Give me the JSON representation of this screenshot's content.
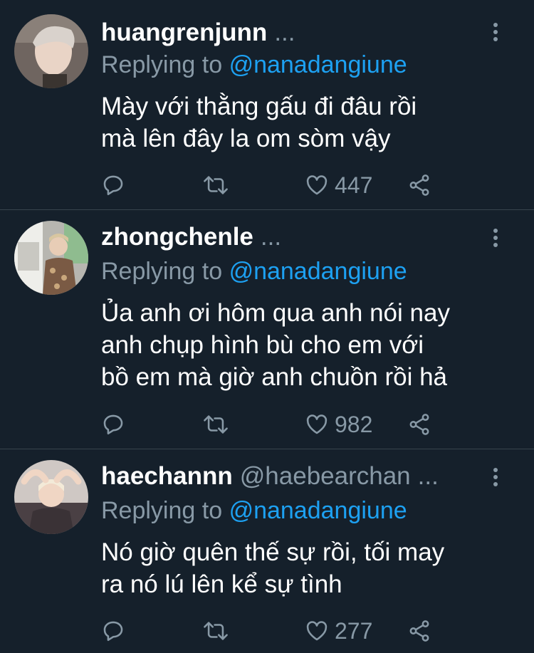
{
  "tweets": [
    {
      "name": "huangrenjunn",
      "handle": "",
      "ellipsis": "...",
      "replying_prefix": "Replying to",
      "replying_to": "@nanadangiune",
      "text": "Mày với thằng gấu đi đâu rồi\nmà lên đây la om sòm vậy",
      "likes": "447"
    },
    {
      "name": "zhongchenle",
      "handle": "",
      "ellipsis": "...",
      "replying_prefix": "Replying to",
      "replying_to": "@nanadangiune",
      "text": "Ủa anh ơi hôm qua anh nói nay\nanh chụp hình bù cho em với\nbồ em mà giờ anh chuồn rồi hả",
      "likes": "982"
    },
    {
      "name": "haechannn",
      "handle": "@haebearchan",
      "ellipsis": "...",
      "replying_prefix": "Replying to",
      "replying_to": "@nanadangiune",
      "text": "Nó giờ quên thế sự rồi, tối may\nra nó lú lên kể sự tình",
      "likes": "277"
    }
  ],
  "icons": {
    "reply": "reply-icon",
    "retweet": "retweet-icon",
    "like": "heart-icon",
    "share": "share-icon",
    "more": "more-vertical-icon"
  },
  "colors": {
    "background": "#15202b",
    "text": "#ffffff",
    "secondary": "#8899a6",
    "link": "#1da1f2",
    "divider": "#38444d"
  }
}
